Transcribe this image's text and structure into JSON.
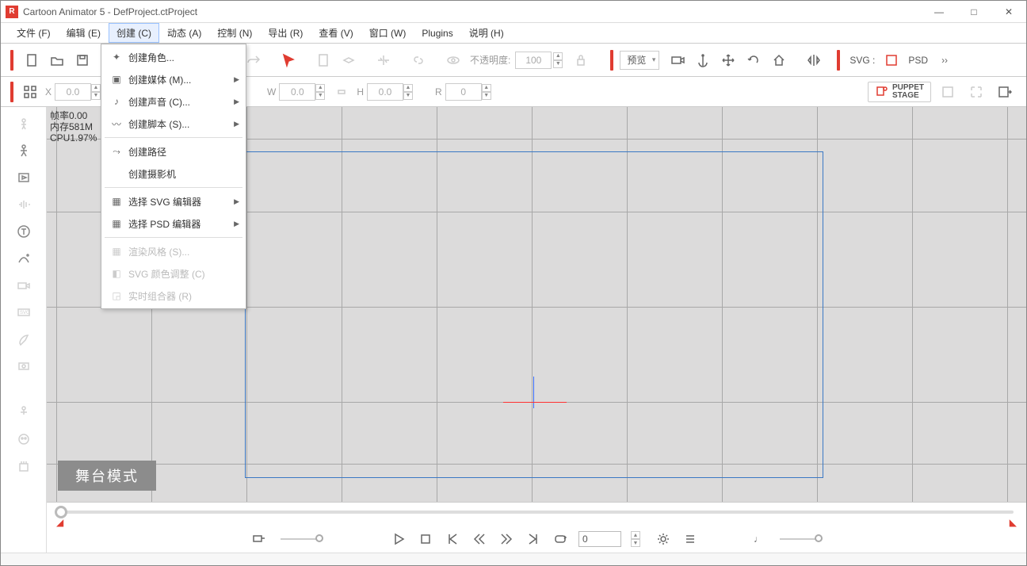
{
  "title": "Cartoon Animator 5 - DefProject.ctProject",
  "menubar": {
    "file": "文件 (F)",
    "edit": "编辑 (E)",
    "create": "创建 (C)",
    "animate": "动态 (A)",
    "control": "控制 (N)",
    "export": "导出 (R)",
    "view": "查看 (V)",
    "window": "窗口 (W)",
    "plugins": "Plugins",
    "help": "说明 (H)"
  },
  "dropdown": {
    "create_char": "创建角色...",
    "create_media": "创建媒体 (M)...",
    "create_sound": "创建声音 (C)...",
    "create_script": "创建脚本 (S)...",
    "create_path": "创建路径",
    "create_camera": "创建摄影机",
    "svg_editor": "选择 SVG 编辑器",
    "psd_editor": "选择 PSD 编辑器",
    "render_style": "渲染风格 (S)...",
    "svg_color": "SVG 颜色调整 (C)",
    "rt_compositor": "实时组合器 (R)"
  },
  "toolbar": {
    "opacity_label": "不透明度:",
    "opacity_value": "100",
    "preview": "预览",
    "svg_label": "SVG :",
    "psd_label": "PSD"
  },
  "toolbar2": {
    "x": "X",
    "x_val": "0.0",
    "w": "W",
    "w_val": "0.0",
    "h": "H",
    "h_val": "0.0",
    "r": "R",
    "r_val": "0",
    "puppet1": "PUPPET",
    "puppet2": "STAGE"
  },
  "stats": {
    "fps": "帧率0.00",
    "mem": "内存581M",
    "cpu": "CPU1.97%"
  },
  "stage_label": "舞台模式",
  "playback": {
    "frame": "0"
  }
}
